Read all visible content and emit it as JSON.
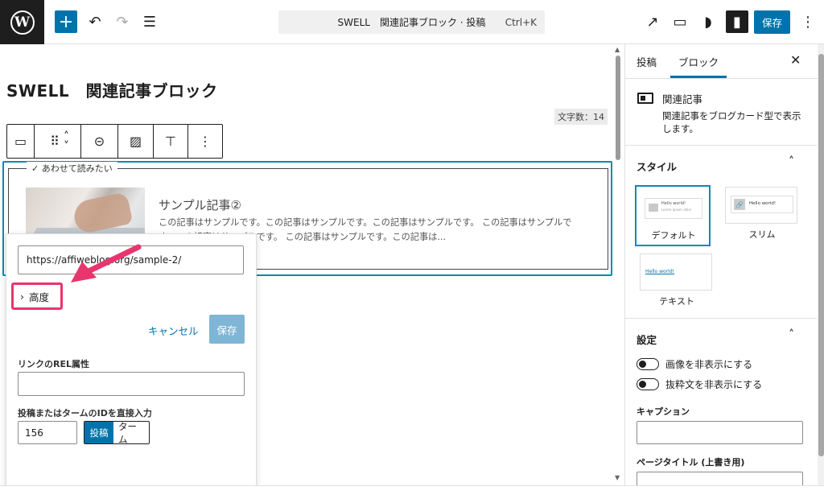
{
  "header": {
    "logo_letter": "W",
    "add_icon": "+",
    "undo_icon": "↶",
    "redo_icon": "↷",
    "outline_icon": "☰",
    "command_title": "SWELL　関連記事ブロック · 投稿",
    "command_shortcut": "Ctrl+K",
    "view_icon": "↗",
    "preview_icon": "▭",
    "swell_icon": "◗",
    "sidebar_icon": "▮",
    "save_label": "保存",
    "more_icon": "⋮"
  },
  "editor": {
    "title": "SWELL　関連記事ブロック",
    "char_count": "文字数：14",
    "toolbar": {
      "block_type_icon": "▭",
      "drag_icon": "⠿",
      "move_up_icon": "˄",
      "move_down_icon": "˅",
      "link_icon": "⊝",
      "image_toggle_icon": "▨",
      "height_icon": "⊤",
      "more_icon": "⋮"
    },
    "related": {
      "caption": "✓ あわせて読みたい",
      "title": "サンプル記事②",
      "excerpt": "この記事はサンプルです。この記事はサンプルです。この記事はサンプルです。 この記事はサンプルです。この記事はサンプルです。 この記事はサンプルです。この記事は..."
    },
    "popover": {
      "url_value": "https://affiweblog.org/sample-2/",
      "advanced_chevron": "›",
      "advanced_label": "高度",
      "cancel_label": "キャンセル",
      "save_label": "保存",
      "rel_label": "リンクのREL属性",
      "id_label": "投稿またはタームのIDを直接入力",
      "id_value": "156",
      "type_post": "投稿",
      "type_term": "ターム"
    }
  },
  "sidebar": {
    "tabs": [
      {
        "label": "投稿"
      },
      {
        "label": "ブロック"
      }
    ],
    "close_icon": "✕",
    "block_name": "関連記事",
    "block_description": "関連記事をブログカード型で表示します。",
    "styles_heading": "スタイル",
    "collapse_icon": "˄",
    "styles": [
      {
        "label": "デフォルト",
        "preview_text": "Hello world!",
        "preview_sub": "Lorem ipsum dolor"
      },
      {
        "label": "スリム",
        "preview_text": "Hello world!"
      },
      {
        "label": "テキスト",
        "preview_text": "Hello world!"
      }
    ],
    "settings_heading": "設定",
    "toggles": [
      {
        "label": "画像を非表示にする"
      },
      {
        "label": "抜粋文を非表示にする"
      }
    ],
    "caption_label": "キャプション",
    "page_title_label": "ページタイトル (上書き用)"
  },
  "colors": {
    "accent": "#0073aa",
    "highlight": "#e8356d",
    "dark": "#1e1e1e"
  }
}
